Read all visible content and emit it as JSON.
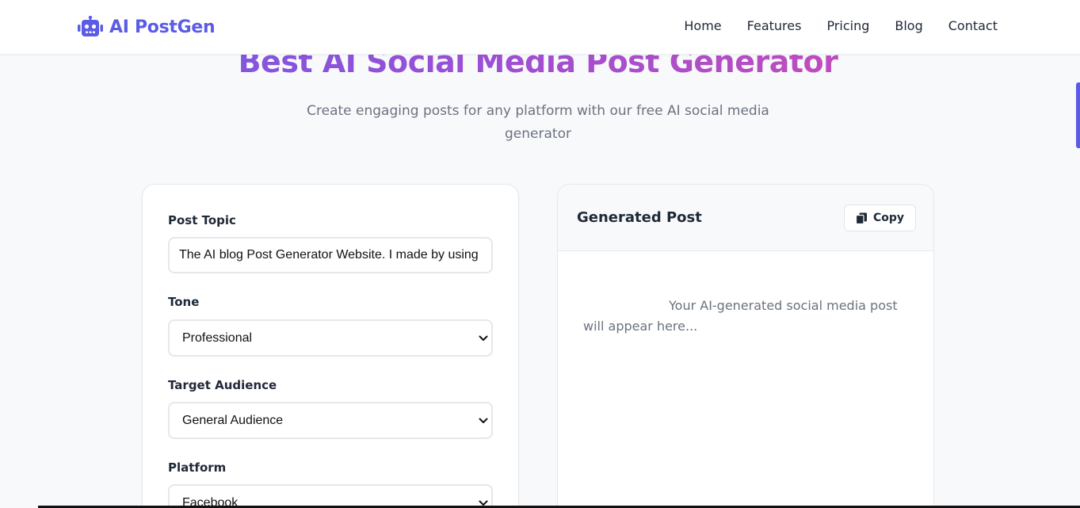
{
  "brand": {
    "name": "AI PostGen",
    "icon": "robot-icon",
    "color": "#5b5ce6"
  },
  "nav": {
    "items": [
      {
        "label": "Home"
      },
      {
        "label": "Features"
      },
      {
        "label": "Pricing"
      },
      {
        "label": "Blog"
      },
      {
        "label": "Contact"
      }
    ]
  },
  "hero": {
    "title": "Best AI Social Media Post Generator",
    "subtitle": "Create engaging posts for any platform with our free AI social media generator"
  },
  "form": {
    "topic": {
      "label": "Post Topic",
      "value": "The AI blog Post Generator Website. I made by using"
    },
    "tone": {
      "label": "Tone",
      "selected": "Professional"
    },
    "audience": {
      "label": "Target Audience",
      "selected": "General Audience"
    },
    "platform": {
      "label": "Platform",
      "selected": "Facebook"
    }
  },
  "output": {
    "title": "Generated Post",
    "copy_label": "Copy",
    "copy_icon": "copy-icon",
    "placeholder": "Your AI-generated social media post will appear here..."
  },
  "colors": {
    "accent": "#5b5ce6",
    "gradient_start": "#6c5ce7",
    "gradient_end": "#d64bb0",
    "text_muted": "#6b7280"
  }
}
